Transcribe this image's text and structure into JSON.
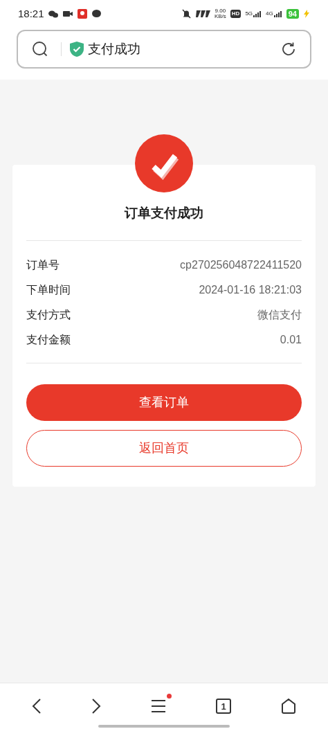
{
  "status_bar": {
    "time": "18:21",
    "speed": "9.00",
    "speed_unit": "KB/s",
    "hd": "HD",
    "network_1": "5G",
    "network_2": "4G",
    "battery": "94"
  },
  "address_bar": {
    "title": "支付成功"
  },
  "result": {
    "title": "订单支付成功",
    "details": [
      {
        "label": "订单号",
        "value": "cp270256048722411520"
      },
      {
        "label": "下单时间",
        "value": "2024-01-16 18:21:03"
      },
      {
        "label": "支付方式",
        "value": "微信支付"
      },
      {
        "label": "支付金额",
        "value": "0.01"
      }
    ],
    "buttons": [
      {
        "kind": "primary",
        "label": "查看订单"
      },
      {
        "kind": "outline",
        "label": "返回首页"
      }
    ]
  },
  "bottom_nav": {
    "tab_count": "1",
    "menu_badge": true
  }
}
